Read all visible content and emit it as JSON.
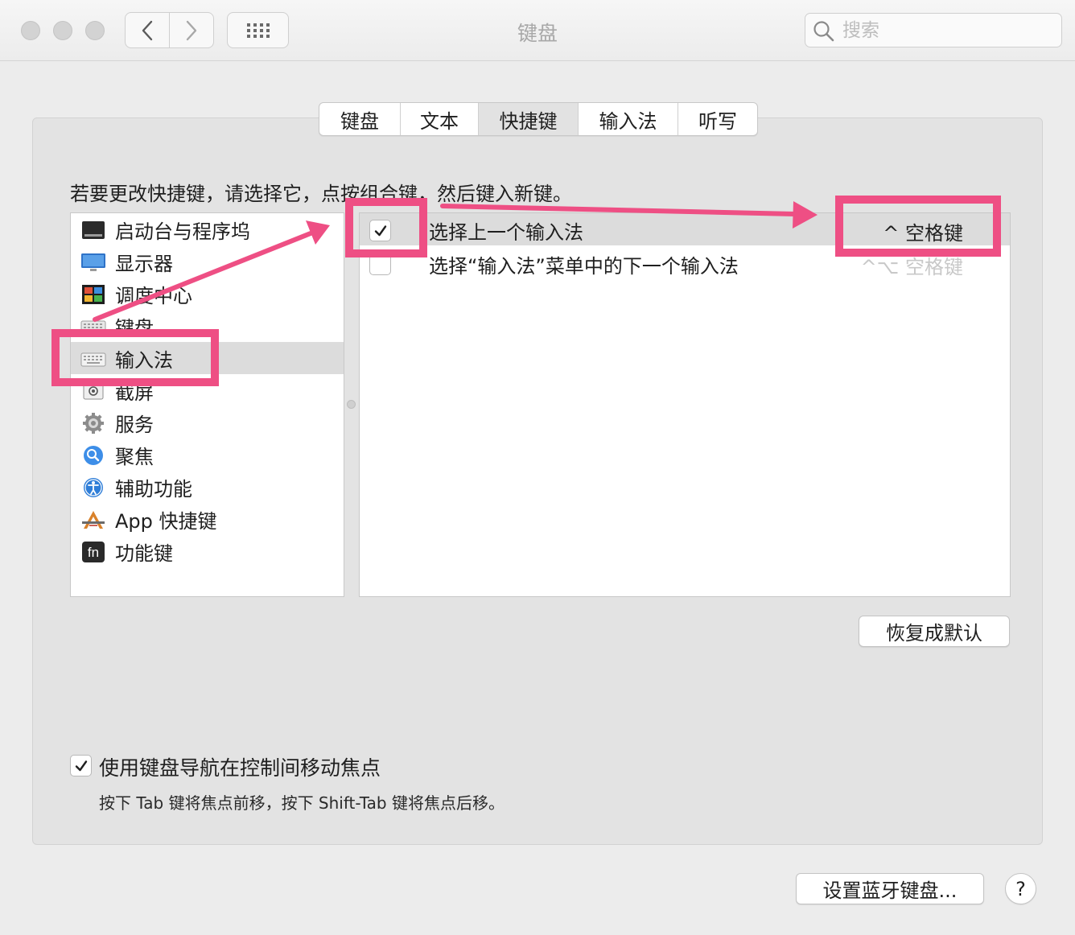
{
  "window": {
    "title": "键盘",
    "search_placeholder": "搜索"
  },
  "tabs": [
    {
      "label": "键盘",
      "active": false
    },
    {
      "label": "文本",
      "active": false
    },
    {
      "label": "快捷键",
      "active": true
    },
    {
      "label": "输入法",
      "active": false
    },
    {
      "label": "听写",
      "active": false
    }
  ],
  "instruction": "若要更改快捷键，请选择它，点按组合键，然后键入新键。",
  "categories": [
    {
      "label": "启动台与程序坞",
      "icon": "launchpad-dock-icon"
    },
    {
      "label": "显示器",
      "icon": "display-icon"
    },
    {
      "label": "调度中心",
      "icon": "mission-control-icon"
    },
    {
      "label": "键盘",
      "icon": "keyboard-icon"
    },
    {
      "label": "输入法",
      "icon": "input-source-icon",
      "selected": true
    },
    {
      "label": "截屏",
      "icon": "screenshot-icon"
    },
    {
      "label": "服务",
      "icon": "gear-icon"
    },
    {
      "label": "聚焦",
      "icon": "spotlight-icon"
    },
    {
      "label": "辅助功能",
      "icon": "accessibility-icon"
    },
    {
      "label": "App 快捷键",
      "icon": "app-shortcuts-icon"
    },
    {
      "label": "功能键",
      "icon": "fn-key-icon"
    }
  ],
  "fn_icon_text": "fn",
  "shortcuts": [
    {
      "label": "选择上一个输入法",
      "key": "^ 空格键",
      "checked": true,
      "selected": true
    },
    {
      "label": "选择“输入法”菜单中的下一个输入法",
      "key": "^⌥ 空格键",
      "checked": false,
      "selected": false
    }
  ],
  "buttons": {
    "restore_defaults": "恢复成默认",
    "setup_bluetooth": "设置蓝牙键盘...",
    "help": "?"
  },
  "keyboard_navigation": {
    "label": "使用键盘导航在控制间移动焦点",
    "checked": true,
    "description": "按下 Tab 键将焦点前移，按下 Shift-Tab 键将焦点后移。"
  },
  "colors": {
    "annotation": "#ee4f84",
    "selection": "#dcdcdc"
  }
}
